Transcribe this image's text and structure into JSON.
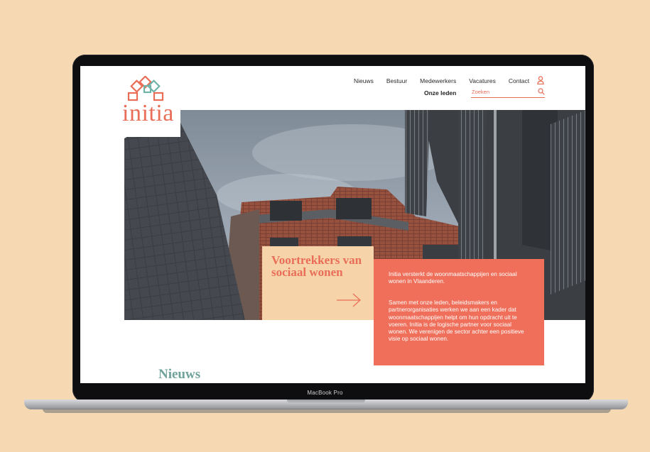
{
  "device": {
    "label": "MacBook Pro"
  },
  "site": {
    "logo_text": "initia",
    "nav": {
      "items": [
        "Nieuws",
        "Bestuur",
        "Medewerkers",
        "Vacatures",
        "Contact"
      ],
      "members_label": "Onze leden"
    },
    "search": {
      "placeholder": "Zoeken"
    }
  },
  "hero": {
    "title": "Voortrekkers van sociaal wonen",
    "intro": "Initia versterkt de woonmaatschappijen en sociaal wonen in Vlaanderen.",
    "body": "Samen met onze leden, beleidsmakers en partnerorganisaties werken we aan een kader dat woonmaatschappijen helpt om hun opdracht uit te voeren. Initia is de logische partner voor sociaal wonen. We verenigen de sector achter een positieve visie op sociaal wonen."
  },
  "news": {
    "heading": "Nieuws"
  },
  "colors": {
    "accent": "#e96d57",
    "coral_panel": "#ef6f5a",
    "tan_panel": "#f7d3a9",
    "news_heading": "#6ea29a",
    "background": "#f6d9b3"
  },
  "icons": [
    "logo-mark-icon",
    "user-icon",
    "search-icon",
    "arrow-right-icon"
  ]
}
